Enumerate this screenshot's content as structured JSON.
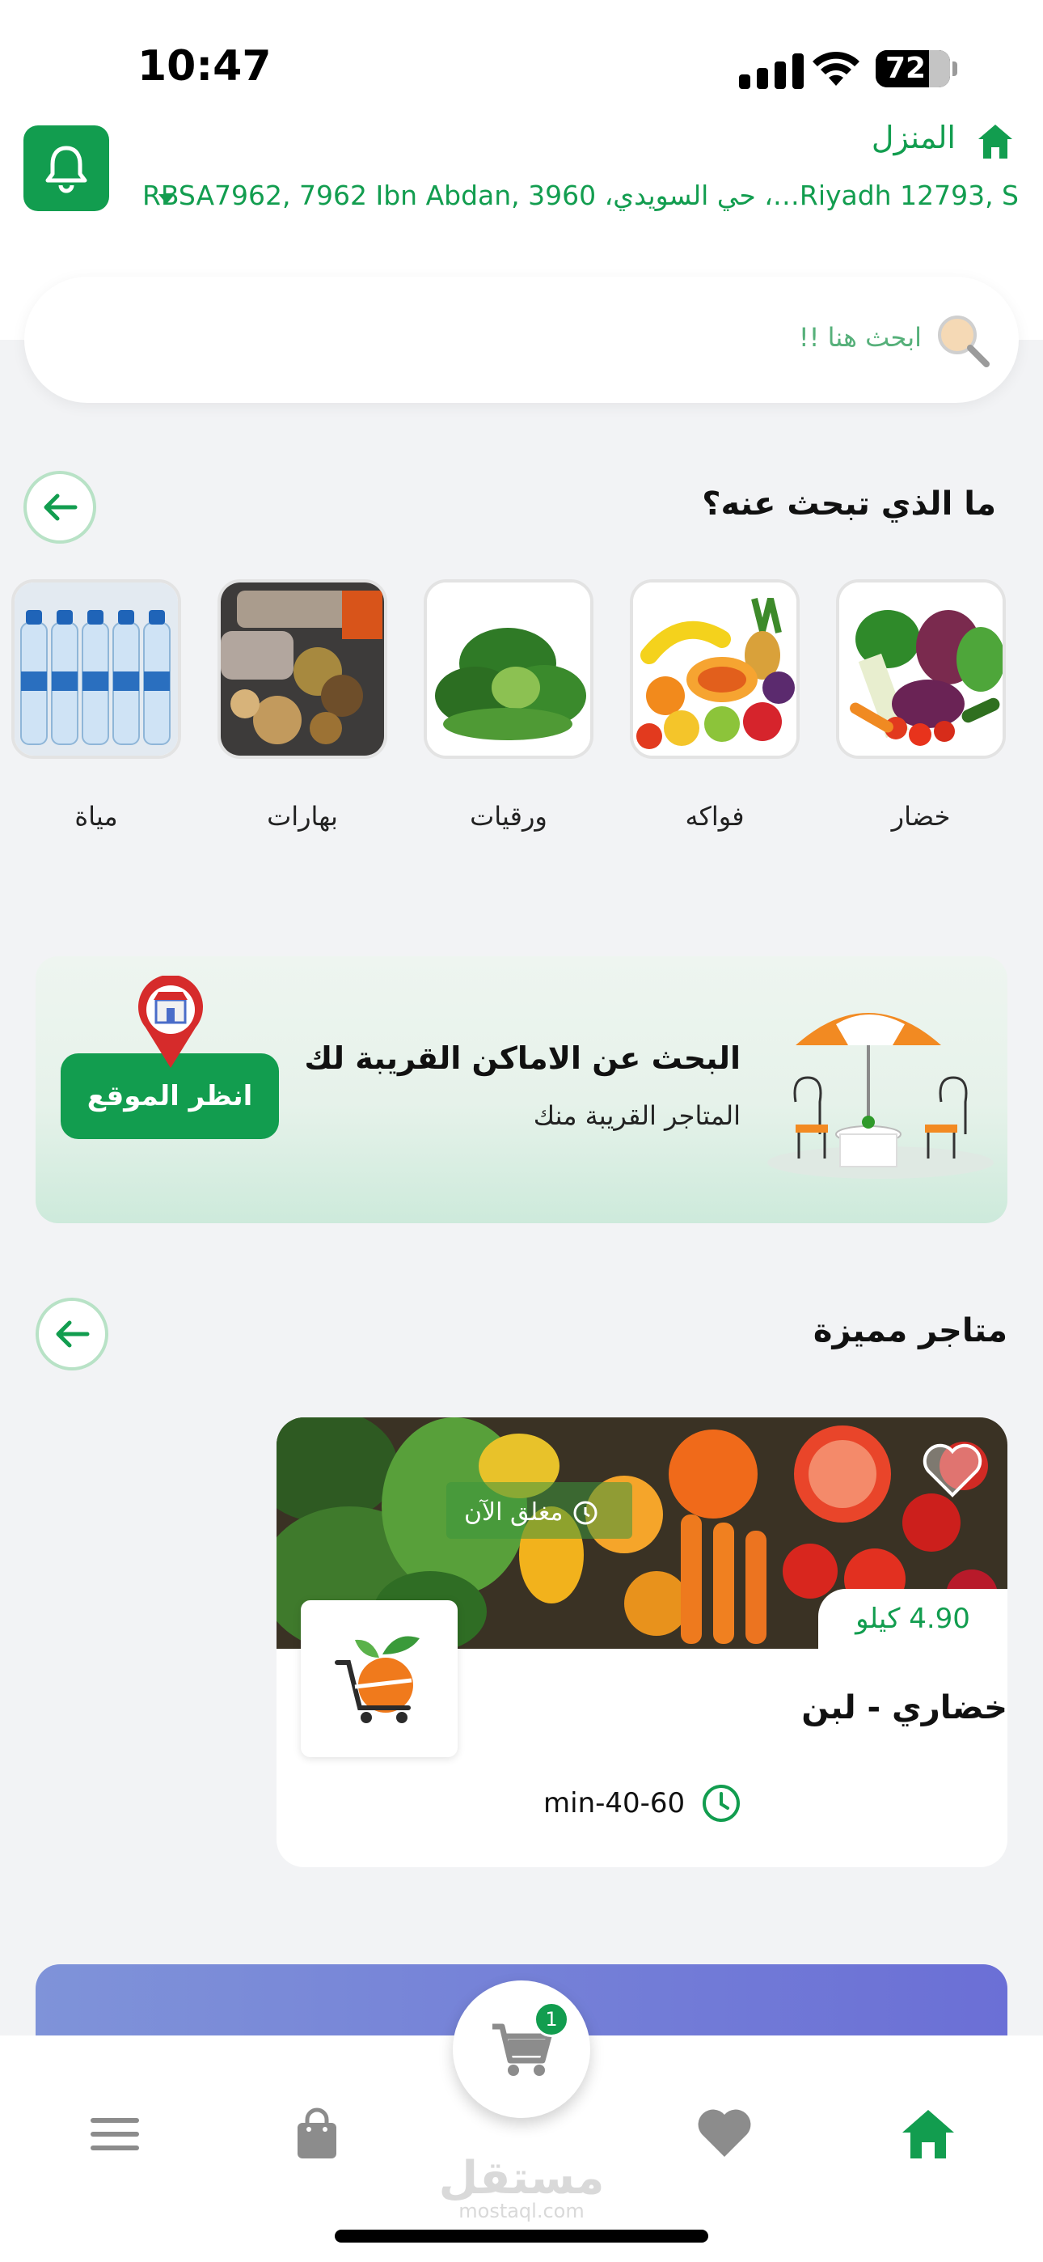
{
  "status_bar": {
    "time": "10:47",
    "battery": "72"
  },
  "header": {
    "home_label": "المنزل",
    "address": "Riyadh 12793, S…، حي السويدي، RBSA7962, 7962 Ibn Abdan, 3960"
  },
  "search": {
    "placeholder": "ابحث هنا !!"
  },
  "categories_section": {
    "title": "ما الذي تبحث عنه؟",
    "items": [
      {
        "label": "خضار",
        "icon": "vegetables-image"
      },
      {
        "label": "فواكه",
        "icon": "fruits-image"
      },
      {
        "label": "ورقيات",
        "icon": "leafy-greens-image"
      },
      {
        "label": "بهارات",
        "icon": "spices-image"
      },
      {
        "label": "مياة",
        "icon": "water-bottles-image"
      }
    ]
  },
  "nearby_banner": {
    "title": "البحث عن الاماكن القريبة لك",
    "subtitle": "المتاجر القريبة منك",
    "button": "انظر الموقع"
  },
  "featured_section": {
    "title": "متاجر مميزة",
    "store": {
      "status": "مغلق الآن",
      "price": "4.90",
      "price_unit": "كيلو",
      "name": "خضاري - لبن",
      "delivery_time": "min-40-60"
    }
  },
  "bottom_nav": {
    "cart_count": "1",
    "items": [
      "home-icon",
      "heart-icon",
      "cart-icon",
      "bag-icon",
      "menu-icon"
    ]
  },
  "watermark": {
    "main": "مستقل",
    "sub": "mostaql.com"
  },
  "colors": {
    "brand_green": "#129d4f",
    "light_green": "#b8e2c6",
    "background": "#f2f3f5"
  }
}
